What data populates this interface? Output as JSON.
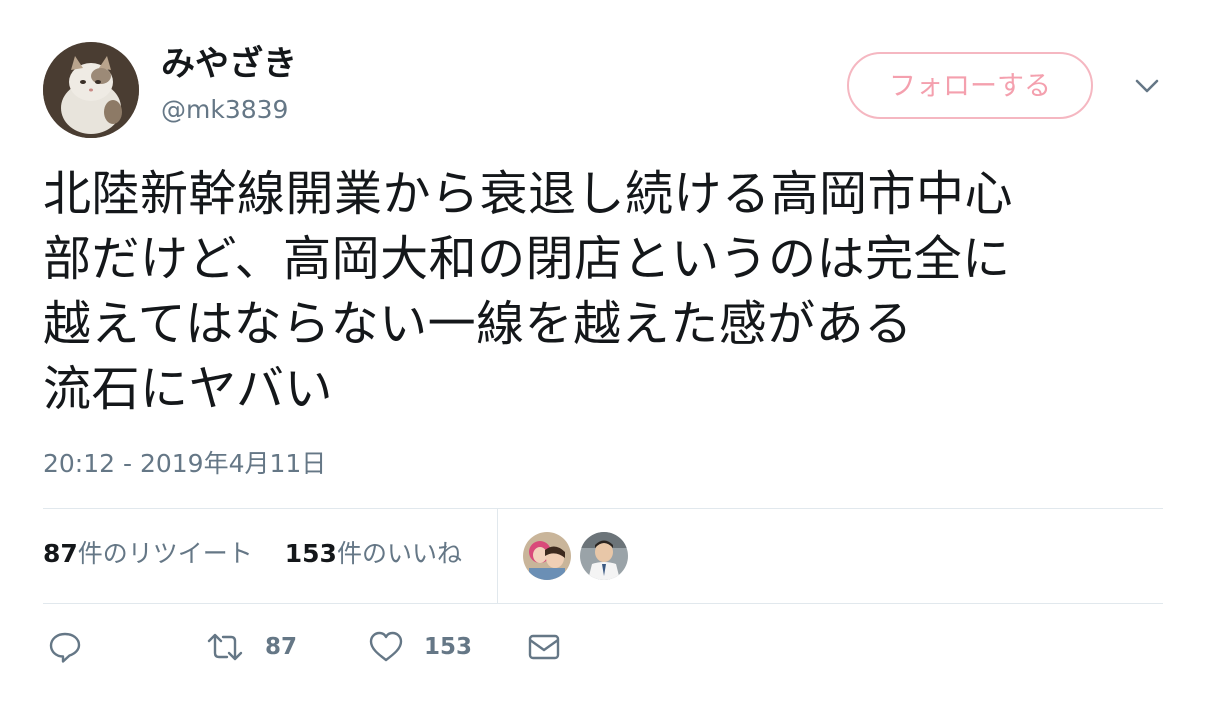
{
  "tweet": {
    "display_name": "みやざき",
    "handle": "@mk3839",
    "follow_label": "フォローする",
    "text": "北陸新幹線開業から衰退し続ける高岡市中心\n部だけど、高岡大和の閉店というのは完全に\n越えてはならない一線を越えた感がある\n流石にヤバい",
    "timestamp": "20:12 - 2019年4月11日"
  },
  "stats": {
    "retweets_count": "87",
    "retweets_label": "件のリツイート",
    "likes_count": "153",
    "likes_label": "件のいいね"
  },
  "actions": {
    "retweet_count": "87",
    "like_count": "153"
  },
  "colors": {
    "follow_border": "#f5b7c1",
    "follow_text": "#f4a0ae",
    "muted": "#657786",
    "divider": "#e1e8ed"
  },
  "icons": [
    "cat-avatar-icon",
    "chevron-down-icon",
    "reply-icon",
    "retweet-icon",
    "heart-icon",
    "mail-icon"
  ]
}
